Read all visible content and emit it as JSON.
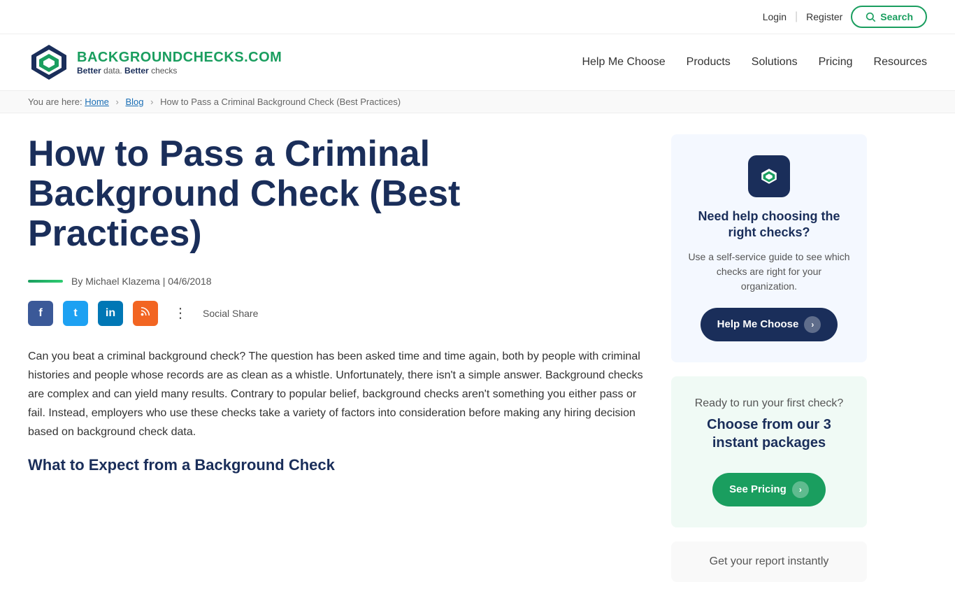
{
  "topbar": {
    "login_label": "Login",
    "register_label": "Register",
    "search_label": "Search"
  },
  "nav": {
    "logo_text_top_part1": "BACKGROUND",
    "logo_text_top_part2": "CHECKS.COM",
    "logo_tagline_part1": "Better",
    "logo_tagline_word1": "data.",
    "logo_tagline_part2": "Better",
    "logo_tagline_word2": "checks",
    "links": [
      {
        "label": "Help Me Choose",
        "id": "help-me-choose"
      },
      {
        "label": "Products",
        "id": "products"
      },
      {
        "label": "Solutions",
        "id": "solutions"
      },
      {
        "label": "Pricing",
        "id": "pricing"
      },
      {
        "label": "Resources",
        "id": "resources"
      }
    ]
  },
  "breadcrumb": {
    "prefix": "You are here:",
    "home": "Home",
    "blog": "Blog",
    "current": "How to Pass a Criminal Background Check (Best Practices)"
  },
  "article": {
    "title": "How to Pass a Criminal Background Check (Best Practices)",
    "author_label": "By Michael Klazema | 04/6/2018",
    "body_p1": "Can you beat a criminal background check? The question has been asked time and time again, both by people with criminal histories and people whose records are as clean as a whistle. Unfortunately, there isn't a simple answer. Background checks are complex and can yield many results. Contrary to popular belief, background checks aren't something you either pass or fail. Instead, employers who use these checks take a variety of factors into consideration before making any hiring decision based on background check data.",
    "subheading": "What to Expect from a Background Check"
  },
  "social": {
    "label": "Social Share"
  },
  "sidebar": {
    "card1": {
      "title": "Need help choosing the right checks?",
      "text": "Use a self-service guide to see which checks are right for your organization.",
      "btn_label": "Help Me Choose"
    },
    "card2": {
      "title": "Ready to run your first check?",
      "bold": "Choose from our 3 instant packages",
      "btn_label": "See Pricing"
    },
    "card3": {
      "text": "Get your report instantly"
    }
  }
}
